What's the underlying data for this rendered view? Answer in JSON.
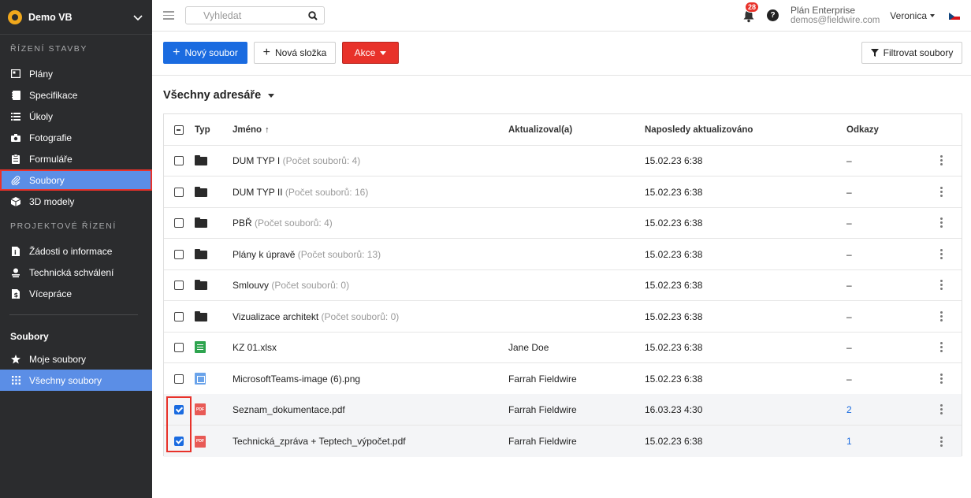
{
  "sidebar": {
    "project": "Demo VB",
    "section_construction": "ŘÍZENÍ STAVBY",
    "construction_items": [
      {
        "label": "Plány",
        "icon": "plans-icon"
      },
      {
        "label": "Specifikace",
        "icon": "specifications-icon"
      },
      {
        "label": "Úkoly",
        "icon": "list-icon"
      },
      {
        "label": "Fotografie",
        "icon": "camera-icon"
      },
      {
        "label": "Formuláře",
        "icon": "clipboard-icon"
      },
      {
        "label": "Soubory",
        "icon": "paperclip-icon"
      },
      {
        "label": "3D modely",
        "icon": "cube-icon"
      }
    ],
    "section_project": "PROJEKTOVÉ ŘÍZENÍ",
    "project_items": [
      {
        "label": "Žádosti o informace",
        "icon": "rfi-icon"
      },
      {
        "label": "Technická schválení",
        "icon": "person-icon"
      },
      {
        "label": "Vícepráce",
        "icon": "change-order-icon"
      }
    ],
    "files_heading": "Soubory",
    "files_items": [
      {
        "label": "Moje soubory",
        "icon": "star-icon"
      },
      {
        "label": "Všechny soubory",
        "icon": "grid-icon"
      }
    ]
  },
  "header": {
    "search_placeholder": "Vyhledat",
    "notifications_count": "28",
    "help": "?",
    "plan_name": "Plán Enterprise",
    "plan_email": "demos@fieldwire.com",
    "user": "Veronica"
  },
  "toolbar": {
    "new_file": "Nový soubor",
    "new_folder": "Nová složka",
    "actions": "Akce",
    "filter": "Filtrovat soubory"
  },
  "directory_title": "Všechny adresáře",
  "table": {
    "columns": {
      "type": "Typ",
      "name": "Jméno",
      "updated_by": "Aktualizoval(a)",
      "updated_at": "Naposledy aktualizováno",
      "links": "Odkazy"
    },
    "rows": [
      {
        "type": "folder",
        "name": "DUM TYP I",
        "count": "(Počet souborů: 4)",
        "by": "",
        "date": "15.02.23 6:38",
        "links": "–",
        "checked": false
      },
      {
        "type": "folder",
        "name": "DUM TYP II",
        "count": "(Počet souborů: 16)",
        "by": "",
        "date": "15.02.23 6:38",
        "links": "–",
        "checked": false
      },
      {
        "type": "folder",
        "name": "PBŘ",
        "count": "(Počet souborů: 4)",
        "by": "",
        "date": "15.02.23 6:38",
        "links": "–",
        "checked": false
      },
      {
        "type": "folder",
        "name": "Plány k úpravě",
        "count": "(Počet souborů: 13)",
        "by": "",
        "date": "15.02.23 6:38",
        "links": "–",
        "checked": false
      },
      {
        "type": "folder",
        "name": "Smlouvy",
        "count": "(Počet souborů: 0)",
        "by": "",
        "date": "15.02.23 6:38",
        "links": "–",
        "checked": false
      },
      {
        "type": "folder",
        "name": "Vizualizace architekt",
        "count": "(Počet souborů: 0)",
        "by": "",
        "date": "15.02.23 6:38",
        "links": "–",
        "checked": false
      },
      {
        "type": "xlsx",
        "name": "KZ 01.xlsx",
        "count": "",
        "by": "Jane Doe",
        "date": "15.02.23 6:38",
        "links": "–",
        "checked": false
      },
      {
        "type": "png",
        "name": "MicrosoftTeams-image (6).png",
        "count": "",
        "by": "Farrah Fieldwire",
        "date": "15.02.23 6:38",
        "links": "–",
        "checked": false
      },
      {
        "type": "pdf",
        "name": "Seznam_dokumentace.pdf",
        "count": "",
        "by": "Farrah Fieldwire",
        "date": "16.03.23 4:30",
        "links": "2",
        "checked": true
      },
      {
        "type": "pdf",
        "name": "Technická_zpráva + Teptech_výpočet.pdf",
        "count": "",
        "by": "Farrah Fieldwire",
        "date": "15.02.23 6:38",
        "links": "1",
        "checked": true
      }
    ]
  },
  "colors": {
    "sidebar_bg": "#2b2c2e",
    "accent": "#1a6be0",
    "danger": "#e8322a",
    "active_item": "#5b8ee6"
  }
}
